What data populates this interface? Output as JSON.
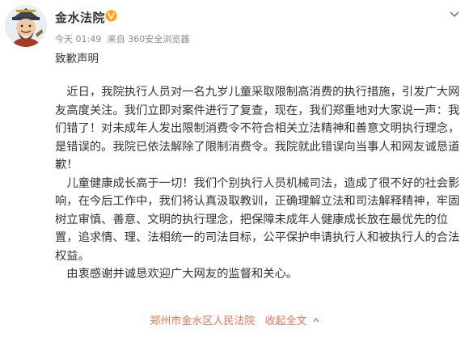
{
  "post": {
    "author": "金水法院",
    "time": "今天 01:49",
    "source": "来自 360安全浏览器",
    "title": "致歉声明",
    "paragraphs": [
      "近日，我院执行人员对一名九岁儿童采取限制高消费的执行措施，引发广大网友高度关注。我们立即对案件进行了复查，现在，我们郑重地对大家说一声：我们错了！对未成年人发出限制消费令不符合相关立法精神和善意文明执行理念，是错误的。我院已依法解除了限制消费令。我院就此错误向当事人和网友诚恳道歉！",
      "儿童健康成长高于一切！我们个别执行人员机械司法，造成了很不好的社会影响，在今后工作中，我们将认真汲取教训，正确理解立法和司法解释精神，牢固树立审慎、善意、文明的执行理念，把保障未成年人健康成长放在最优先的位置，追求情、理、法相统一的司法目标，公平保护申请执行人和被执行人的合法权益。",
      "由衷感谢并诚恳欢迎广大网友的监督和关心。"
    ],
    "signature": "郑州市金水区人民法院",
    "collapse_label": "收起全文"
  },
  "icons": {
    "avatar": "cartoon-judge-avatar",
    "verified": "verified-v-icon",
    "menu": "chevron-down-icon",
    "collapse": "collapse-up-icon"
  },
  "colors": {
    "accent": "#eb7350",
    "verified": "#ffa500",
    "meta": "#888888",
    "text": "#333333"
  }
}
